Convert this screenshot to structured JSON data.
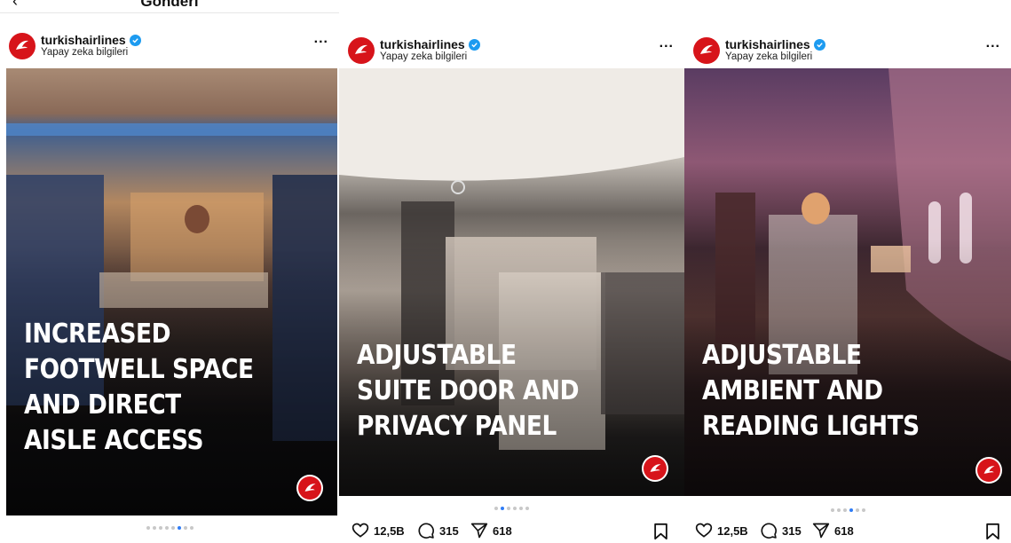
{
  "topbar": {
    "back_glyph": "‹",
    "title": "Gönderi"
  },
  "posts": [
    {
      "username": "turkishairlines",
      "subtitle": "Yapay zeka bilgileri",
      "more": "...",
      "caption_lines": [
        "INCREASED",
        "FOOTWELL SPACE",
        "AND DIRECT",
        "AISLE ACCESS"
      ],
      "dots_total": 8,
      "dots_active": 5
    },
    {
      "username": "turkishairlines",
      "subtitle": "Yapay zeka bilgileri",
      "more": "...",
      "caption_lines": [
        "ADJUSTABLE",
        "SUITE DOOR AND",
        "PRIVACY PANEL"
      ],
      "dots_total": 6,
      "dots_active": 1,
      "likes": "12,5B",
      "comments": "315",
      "shares": "618"
    },
    {
      "username": "turkishairlines",
      "subtitle": "Yapay zeka bilgileri",
      "more": "...",
      "caption_lines": [
        "ADJUSTABLE",
        "AMBIENT AND",
        "READING LIGHTS"
      ],
      "dots_total": 6,
      "dots_active": 3,
      "likes": "12,5B",
      "comments": "315",
      "shares": "618"
    }
  ],
  "icons": {
    "avatar": "turkish-airlines-logo-icon",
    "verified": "verified-badge-icon",
    "like": "heart-icon",
    "comment": "comment-icon",
    "share": "send-icon",
    "save": "bookmark-icon"
  },
  "colors": {
    "brand_red": "#d7141a",
    "verified_blue": "#1d9bf0",
    "dot_active": "#2f7cf6"
  }
}
